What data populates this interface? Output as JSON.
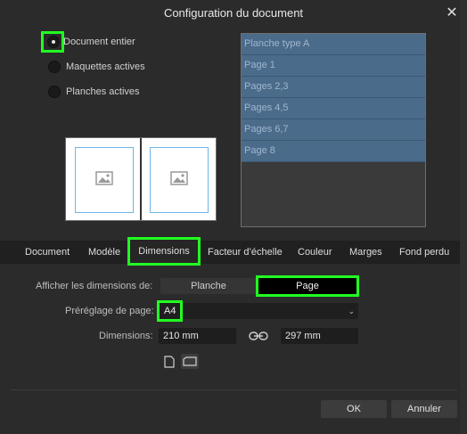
{
  "dialog": {
    "title": "Configuration du document"
  },
  "scope": {
    "options": [
      {
        "label": "Document entier",
        "checked": true
      },
      {
        "label": "Maquettes actives",
        "checked": false
      },
      {
        "label": "Planches actives",
        "checked": false
      }
    ]
  },
  "spreads": [
    "Planche type A",
    "Page 1",
    "Pages 2,3",
    "Pages 4,5",
    "Pages 6,7",
    "Page 8"
  ],
  "tabs": [
    "Document",
    "Modèle",
    "Dimensions",
    "Facteur d’échelle",
    "Couleur",
    "Marges",
    "Fond perdu"
  ],
  "active_tab": "Dimensions",
  "dimensions_panel": {
    "show_label": "Afficher les dimensions de:",
    "seg_spread": "Planche",
    "seg_page": "Page",
    "preset_label": "Préréglage de page:",
    "preset_value": "A4",
    "dimensions_label": "Dimensions:",
    "width": "210 mm",
    "height": "297 mm"
  },
  "buttons": {
    "ok": "OK",
    "cancel": "Annuler"
  },
  "colors": {
    "accent_highlight": "#22ff22",
    "list_item": "#4b6b8b",
    "page_frame": "#6bb7e6"
  }
}
